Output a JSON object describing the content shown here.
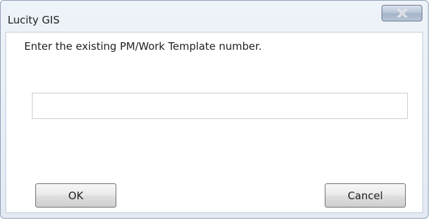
{
  "window": {
    "title": "Lucity GIS",
    "close_icon": "close-x-icon"
  },
  "dialog": {
    "prompt": "Enter the existing PM/Work Template number.",
    "input_value": "",
    "ok_label": "OK",
    "cancel_label": "Cancel"
  },
  "colors": {
    "close_button": "#b3c1d4",
    "window_border": "#8f9fb4",
    "client_background": "#ffffff"
  }
}
